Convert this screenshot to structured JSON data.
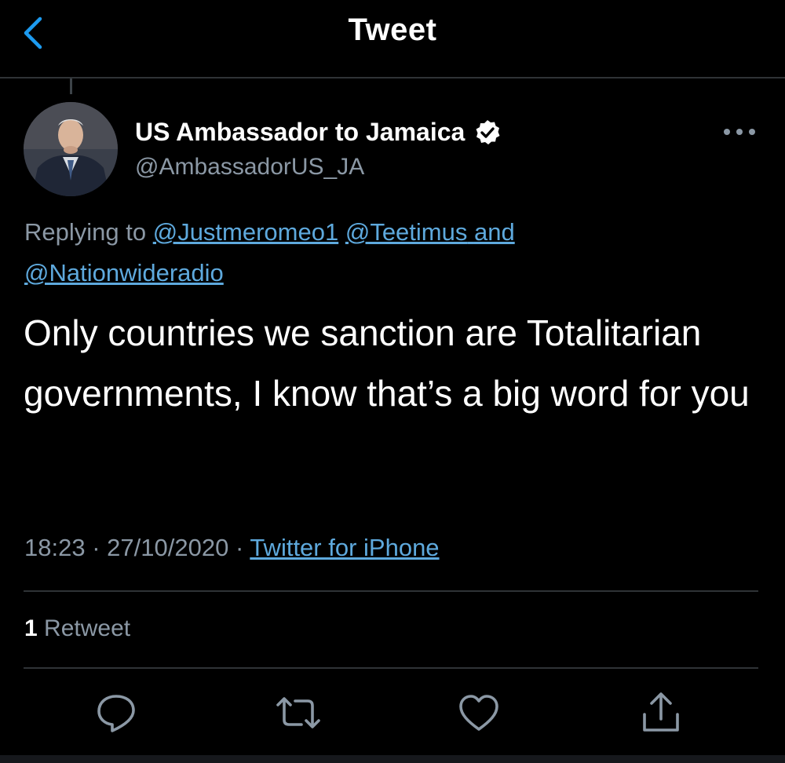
{
  "header": {
    "title": "Tweet",
    "back_icon": "chevron-left-icon"
  },
  "author": {
    "display_name": "US Ambassador to Jamaica",
    "handle": "@AmbassadorUS_JA",
    "verified_icon": "verified-badge-icon"
  },
  "reply_context": {
    "prefix": "Replying to",
    "mentions": [
      "@Justmeromeo1",
      "@Teetimus",
      "@Nationwideradio"
    ],
    "conjunction": "and"
  },
  "tweet": {
    "text": "Only countries we sanction are Totalitarian governments, I know that’s a big word for you"
  },
  "meta": {
    "time": "18:23",
    "date": "27/10/2020",
    "separator": "·",
    "source": "Twitter for iPhone"
  },
  "stats": {
    "retweet_count": "1",
    "retweet_label": "Retweet"
  },
  "actions": [
    {
      "icon": "reply-icon"
    },
    {
      "icon": "retweet-icon"
    },
    {
      "icon": "like-icon"
    },
    {
      "icon": "share-icon"
    }
  ],
  "colors": {
    "background": "#000000",
    "link": "#5ea9dd",
    "secondary_text": "#8b98a5",
    "divider": "#2f3336"
  }
}
